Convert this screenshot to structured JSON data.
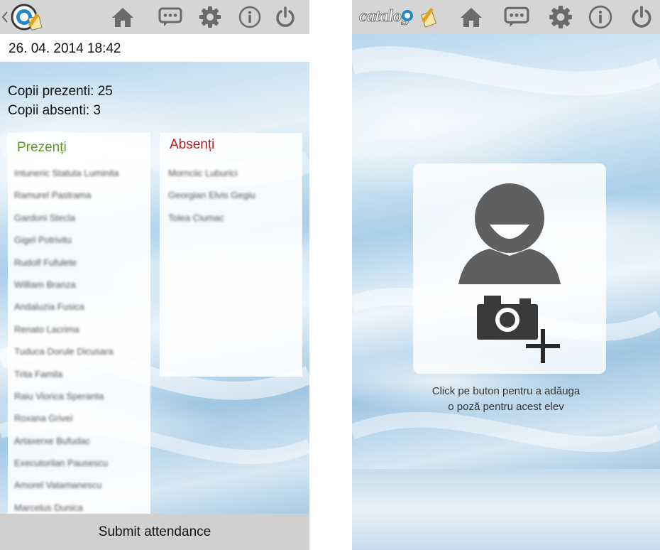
{
  "left_screen": {
    "header": {
      "icons": [
        "back-chevron",
        "app-logo",
        "home",
        "messages",
        "settings",
        "info",
        "power"
      ]
    },
    "datetime": "26. 04. 2014  18:42",
    "counts": {
      "present": "Copii prezenti: 25",
      "absent": "Copii absenti: 3"
    },
    "present_panel": {
      "title": "Prezenți",
      "names": [
        "Intuneric Statuta Luminita",
        "Ramurel Pastrama",
        "Gardoni Stecla",
        "Gigel Potrivitu",
        "Rudolf Fufulete",
        "William Branza",
        "Andaluzia Fusica",
        "Renato Lacrima",
        "Tuduca Dorule Dicusara",
        "Trita Famila",
        "Raiu Viorica Speranta",
        "Roxana Grivei",
        "Artaxerxe Bufudac",
        "Executorilan Pausescu",
        "Amorel Vatamanescu",
        "Marcelus Dunica"
      ]
    },
    "absent_panel": {
      "title": "Absenți",
      "names": [
        "Mornciic Luburici",
        "Georgian Elvis Gegiu",
        "Tolea Ciumac"
      ]
    },
    "submit_label": "Submit attendance"
  },
  "right_screen": {
    "header": {
      "logo_text": "catalog",
      "icons": [
        "app-logo",
        "home",
        "messages",
        "settings",
        "info",
        "power"
      ]
    },
    "photo_hint_line1": "Click pe buton pentru a adăuga",
    "photo_hint_line2": "o poză pentru acest elev"
  },
  "colors": {
    "topbar": "#d5d5d5",
    "icon": "#6a6a6a",
    "present_title": "#5c9b1f",
    "absent_title": "#b71c1c",
    "submit_bar": "#d0d0d0"
  }
}
